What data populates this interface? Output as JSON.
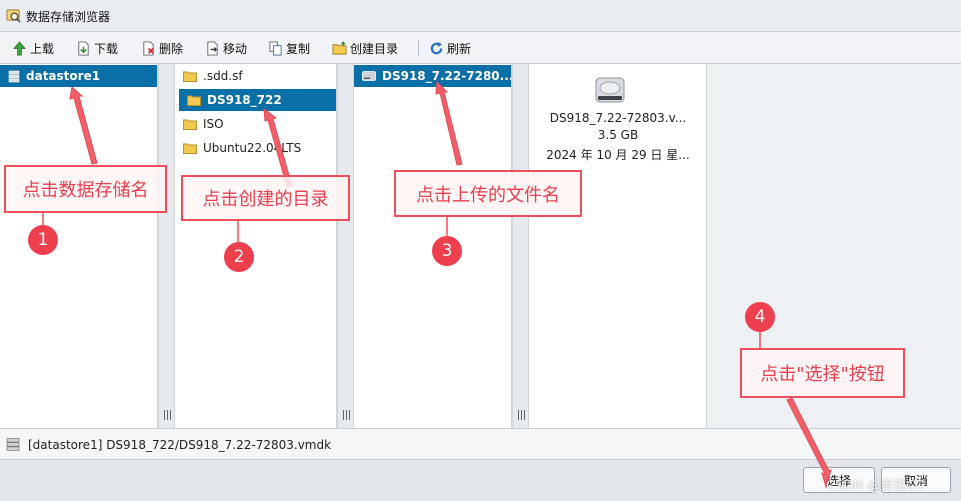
{
  "window": {
    "title": "数据存储浏览器"
  },
  "toolbar": {
    "upload": "上载",
    "download": "下载",
    "delete": "删除",
    "move": "移动",
    "copy": "复制",
    "mkdir": "创建目录",
    "refresh": "刷新"
  },
  "panes": {
    "datastores": [
      {
        "label": "datastore1",
        "selected": true
      }
    ],
    "folders": [
      {
        "label": ".sdd.sf",
        "selected": false
      },
      {
        "label": "DS918_722",
        "selected": true
      },
      {
        "label": "ISO",
        "selected": false
      },
      {
        "label": "Ubuntu22.04LTS",
        "selected": false
      }
    ],
    "files": [
      {
        "label": "DS918_7.22-7280...",
        "selected": true
      }
    ],
    "detail": {
      "name": "DS918_7.22-72803.v...",
      "size": "3.5 GB",
      "date": "2024 年 10 月 29 日 星..."
    }
  },
  "status": {
    "path": "[datastore1] DS918_722/DS918_7.22-72803.vmdk"
  },
  "buttons": {
    "select": "选择",
    "cancel": "取消"
  },
  "annotations": {
    "step1": {
      "num": "1",
      "text": "点击数据存储名"
    },
    "step2": {
      "num": "2",
      "text": "点击创建的目录"
    },
    "step3": {
      "num": "3",
      "text": "点击上传的文件名"
    },
    "step4": {
      "num": "4",
      "text": "点击\"选择\"按钮"
    }
  },
  "watermark": "CSDN @青锐CC",
  "colors": {
    "selection": "#0a6fa6",
    "annotation": "#ef4f5b",
    "folder": "#f3c94f"
  }
}
